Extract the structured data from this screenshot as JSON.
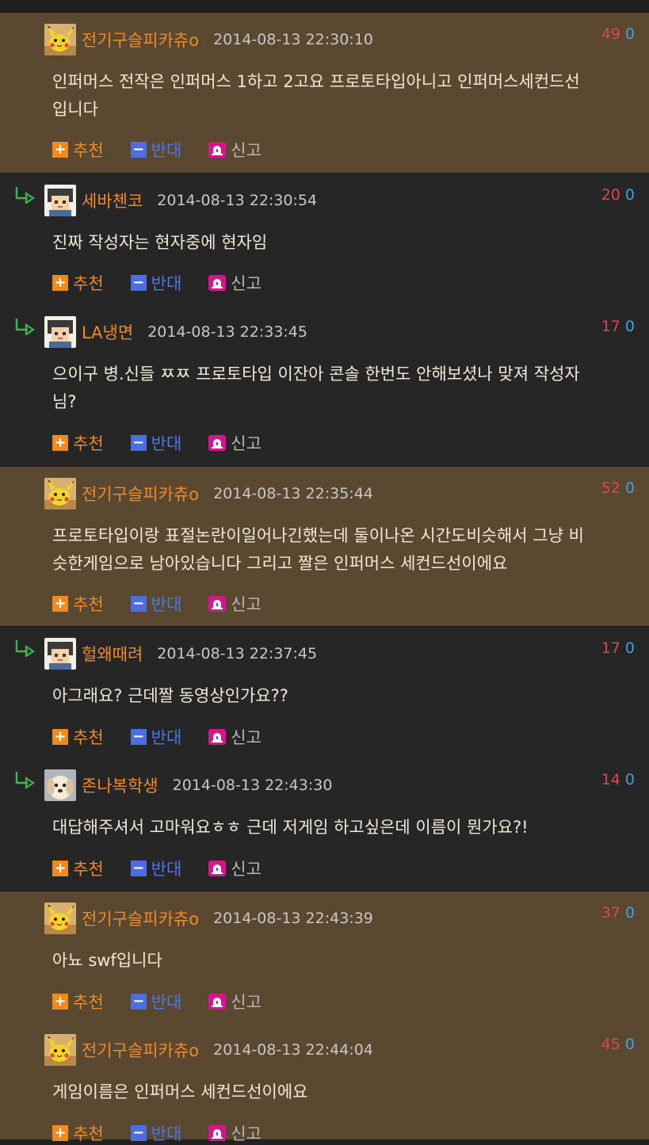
{
  "comments": [
    {
      "type": "op",
      "reply": false,
      "avatar": "pikachu",
      "nick": "전기구슬피카츄o",
      "date": "2014-08-13 22:30:10",
      "up": "49",
      "down": "0",
      "lines": [
        "인퍼머스 전작은 인퍼머스 1하고 2고요 프로토타입아니고 인퍼머스세컨드선",
        "입니다"
      ]
    },
    {
      "type": "other",
      "reply": true,
      "avatar": "pixel-man",
      "nick": "세바첸코",
      "date": "2014-08-13 22:30:54",
      "up": "20",
      "down": "0",
      "lines": [
        "진짜 작성자는 현자중에 현자임"
      ]
    },
    {
      "type": "other",
      "reply": true,
      "avatar": "pixel-man",
      "nick": "LA냉면",
      "date": "2014-08-13 22:33:45",
      "up": "17",
      "down": "0",
      "lines": [
        "으이구 병.신들 ㅉㅉ 프로토타입 이잔아 콘솔 한번도 안해보셨나 맞져 작성자",
        "님?"
      ]
    },
    {
      "type": "op",
      "reply": false,
      "avatar": "pikachu",
      "nick": "전기구슬피카츄o",
      "date": "2014-08-13 22:35:44",
      "up": "52",
      "down": "0",
      "lines": [
        "프로토타입이랑 표절논란이일어나긴했는데 둘이나온 시간도비슷해서 그냥 비",
        "슷한게임으로 남아있습니다 그리고 짤은 인퍼머스 세컨드선이에요"
      ]
    },
    {
      "type": "other",
      "reply": true,
      "avatar": "pixel-man",
      "nick": "헐왜때려",
      "date": "2014-08-13 22:37:45",
      "up": "17",
      "down": "0",
      "lines": [
        "아그래요? 근데짤 동영상인가요??"
      ]
    },
    {
      "type": "other",
      "reply": true,
      "avatar": "puppy",
      "nick": "존나복학생",
      "date": "2014-08-13 22:43:30",
      "up": "14",
      "down": "0",
      "lines": [
        "대답해주셔서 고마워요ㅎㅎ 근데 저게임 하고싶은데 이름이 뭔가요?!"
      ]
    },
    {
      "type": "op",
      "reply": false,
      "avatar": "pikachu",
      "nick": "전기구슬피카츄o",
      "date": "2014-08-13 22:43:39",
      "up": "37",
      "down": "0",
      "lines": [
        "아뇨 swf입니다"
      ]
    },
    {
      "type": "op",
      "reply": false,
      "avatar": "pikachu",
      "nick": "전기구슬피카츄o",
      "date": "2014-08-13 22:44:04",
      "up": "45",
      "down": "0",
      "lines": [
        "게임이름은 인퍼머스 세컨드선이에요"
      ]
    }
  ],
  "actions": {
    "recommend": "추천",
    "oppose": "반대",
    "report": "신고"
  },
  "icons": {
    "reply": "reply-arrow-icon",
    "recommend": "plus-icon",
    "oppose": "minus-icon",
    "report": "siren-icon"
  },
  "colors": {
    "op_bg": "#5a4930",
    "other_bg": "#262626",
    "nick": "#ef8a2a",
    "up": "#e0454a",
    "down": "#3aa2e3"
  }
}
